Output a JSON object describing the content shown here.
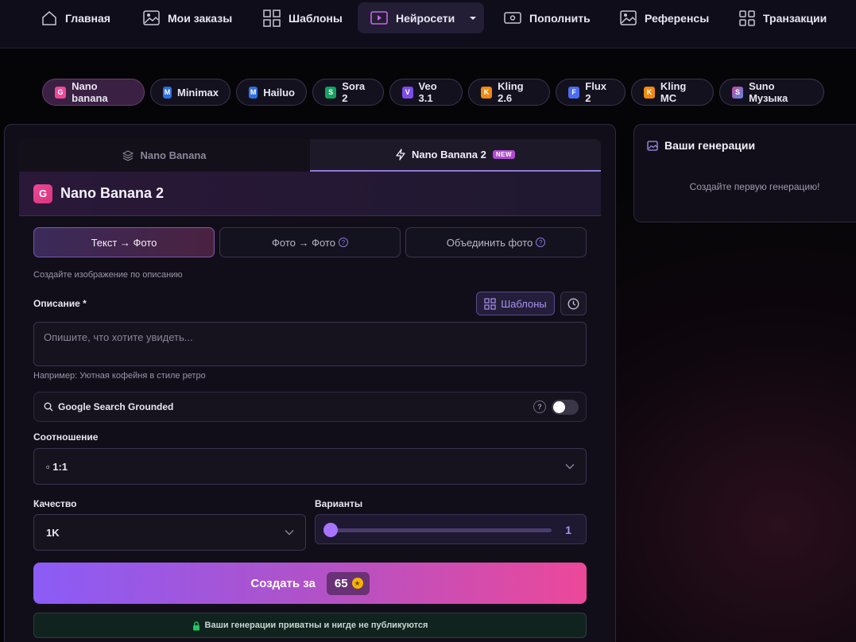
{
  "nav": {
    "items": [
      {
        "label": "Главная",
        "icon": "home-icon"
      },
      {
        "label": "Мои заказы",
        "icon": "image-icon"
      },
      {
        "label": "Шаблоны",
        "icon": "grid-icon"
      },
      {
        "label": "Нейросети",
        "icon": "play-icon",
        "active": true
      },
      {
        "label": "Пополнить",
        "icon": "wallet-icon"
      },
      {
        "label": "Референсы",
        "icon": "image-icon"
      },
      {
        "label": "Транзакции",
        "icon": "grid-icon"
      }
    ]
  },
  "models": [
    {
      "badge": "G",
      "label": "Nano banana",
      "color": "#ec4899",
      "active": true
    },
    {
      "badge": "M",
      "label": "Minimax",
      "color": "#2f6fe0"
    },
    {
      "badge": "M",
      "label": "Hailuo",
      "color": "#2f6fe0"
    },
    {
      "badge": "S",
      "label": "Sora 2",
      "color": "#15a060"
    },
    {
      "badge": "V",
      "label": "Veo 3.1",
      "color": "#7c4de8"
    },
    {
      "badge": "K",
      "label": "Kling 2.6",
      "color": "#f08a10"
    },
    {
      "badge": "F",
      "label": "Flux 2",
      "color": "#4a6cf0"
    },
    {
      "badge": "K",
      "label": "Kling MC",
      "color": "#f08a10"
    },
    {
      "badge": "S",
      "label": "Suno Музыка",
      "color": "#c04aa0"
    }
  ],
  "tabs": {
    "first": "Nano Banana",
    "second": "Nano Banana 2",
    "new_badge": "NEW"
  },
  "model_header": {
    "badge": "G",
    "title": "Nano Banana 2"
  },
  "modes": [
    {
      "label": "Текст → Фото",
      "active": true
    },
    {
      "label": "Фото → Фото",
      "help": "?"
    },
    {
      "label": "Объединить фото",
      "help": "?"
    }
  ],
  "mode_hint": "Создайте изображение по описанию",
  "description": {
    "label": "Описание *",
    "templates_button": "Шаблоны",
    "placeholder": "Опишите, что хотите увидеть...",
    "example": "Например: Уютная кофейня в стиле ретро"
  },
  "google_search": {
    "label": "Google Search Grounded",
    "help": "?",
    "enabled": false
  },
  "ratio": {
    "label": "Соотношение",
    "value": "▫ 1:1"
  },
  "quality": {
    "label": "Качество",
    "value": "1K"
  },
  "variants": {
    "label": "Варианты",
    "value": "1",
    "fraction": 0
  },
  "create": {
    "label": "Создать за",
    "price": "65",
    "coin_glyph": "★"
  },
  "privacy": "Ваши генерации приватны и нигде не публикуются",
  "generations": {
    "title": "Ваши генерации",
    "empty": "Создайте первую генерацию!"
  },
  "colors": {
    "accent": "#8b5cf6",
    "pink": "#ec4899",
    "nav_bg": "#0f0d1a",
    "panel_bg": "#110e19"
  }
}
